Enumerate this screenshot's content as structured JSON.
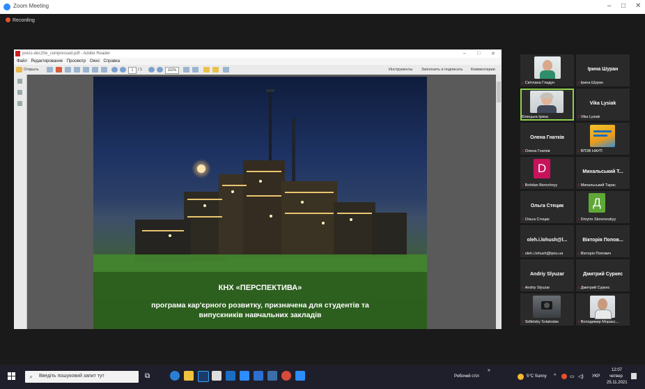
{
  "zoom": {
    "title": "Zoom Meeting",
    "recording": "Recording",
    "controls": [
      "–",
      "□",
      "✕"
    ]
  },
  "adobe": {
    "title": "prezs-dec20e_compressed.pdf - Adobe Reader",
    "menu": [
      "Файл",
      "Редактирование",
      "Просмотр",
      "Окно",
      "Справка"
    ],
    "open": "Открыть",
    "page_current": "1",
    "page_total": "/ 1",
    "zoom": "102%",
    "tools": "Инструменты",
    "fill_sign": "Заполнить и подписать",
    "comments": "Комментарии"
  },
  "slide": {
    "heading": "КНХ «ПЕРСПЕКТИВА»",
    "subheading": "програма кар'єрного розвитку, призначена для студентів та випускників навчальних закладів"
  },
  "participants": [
    {
      "name": "",
      "label": "Світлана Гладун",
      "avatar": "photo-woman"
    },
    {
      "name": "Ірина Шуран",
      "label": "Ірина Шуран"
    },
    {
      "name": "",
      "label": "Білецька Ірина",
      "avatar": "photo-woman-glasses",
      "active": true
    },
    {
      "name": "Vika Lysiak",
      "label": "Vika Lysiak"
    },
    {
      "name": "Олена Гнатків",
      "label": "Олена Гнатків"
    },
    {
      "name": "",
      "label": "ВПЗВ НАУП",
      "avatar": "book-cover"
    },
    {
      "name": "",
      "label": "Bohdan Berezhnyy",
      "avatar": "letter-D"
    },
    {
      "name": "Михальський Т...",
      "label": "Михальський Тарас"
    },
    {
      "name": "Ольга Стецик",
      "label": "Ольга Стецик"
    },
    {
      "name": "",
      "label": "Dmytro Skovronskyy",
      "avatar": "letter-Д"
    },
    {
      "name": "oleh.i.lohush@l...",
      "label": "oleh.i.lohush@lpnu.ua"
    },
    {
      "name": "Вікторія Попов...",
      "label": "Вікторія Попович"
    },
    {
      "name": "Andriy Slyuzar",
      "label": "Andriy Slyuzar"
    },
    {
      "name": "Дмитрий Суркес",
      "label": "Дмитрий Суркес"
    },
    {
      "name": "",
      "label": "Sidletsky Sviatoslav",
      "avatar": "photo-camera"
    },
    {
      "name": "",
      "label": "Володимир Мораєс...",
      "avatar": "photo-man"
    }
  ],
  "avatar_letters": {
    "d": "D",
    "dd": "Д"
  },
  "taskbar": {
    "search_placeholder": "Введіть пошуковий запит тут",
    "desktop": "Робочий стіл",
    "weather": "5°C  Sunny",
    "lang": "УКР",
    "time": "12:07",
    "day": "четвер",
    "date": "25.11.2021"
  },
  "colors": {
    "zoom_blue": "#2d8cff",
    "active_speaker": "#8fd14f",
    "avatar_d": "#c8135c",
    "avatar_dd": "#5fa838"
  }
}
